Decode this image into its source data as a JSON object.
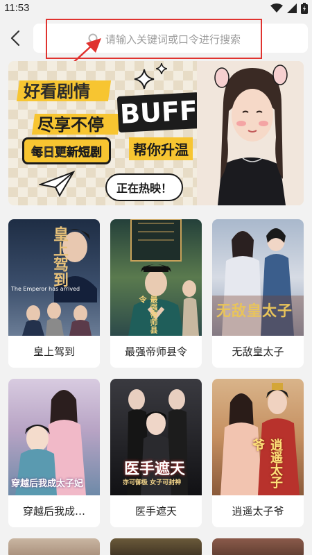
{
  "status_bar": {
    "time": "11:53",
    "icons": [
      "wifi-icon",
      "signal-icon",
      "battery-icon"
    ]
  },
  "search": {
    "placeholder": "请输入关键词或口令进行搜索"
  },
  "banner": {
    "line1": "好看剧情",
    "line2": "尽享不停",
    "buff": "BUFF",
    "tag": "每日更新短剧",
    "help": "帮你升温",
    "bubble": "正在热映！"
  },
  "dramas": [
    {
      "title": "皇上驾到",
      "poster_text": "皇上驾到",
      "poster_caption": "The Emperor has arrived",
      "color": "#2c3e55"
    },
    {
      "title": "最强帝师县令",
      "poster_text": "最强帝师县令",
      "poster_caption": "",
      "color": "#2f5a4a"
    },
    {
      "title": "无敌皇太子",
      "poster_text": "无敌皇太子",
      "poster_caption": "",
      "color": "#6a7fa0"
    },
    {
      "title": "穿越后我成…",
      "poster_text": "穿越后我成太子妃",
      "poster_caption": "",
      "color": "#8a6a84"
    },
    {
      "title": "医手遮天",
      "poster_text": "医手遮天",
      "poster_caption": "亦可御极 女子可封神",
      "color": "#2a2a2e"
    },
    {
      "title": "逍遥太子爷",
      "poster_text": "逍遥太子爷",
      "poster_caption": "",
      "color": "#b37a54"
    }
  ],
  "colors": {
    "accent": "#f7c531",
    "highlight": "#e0332f"
  }
}
